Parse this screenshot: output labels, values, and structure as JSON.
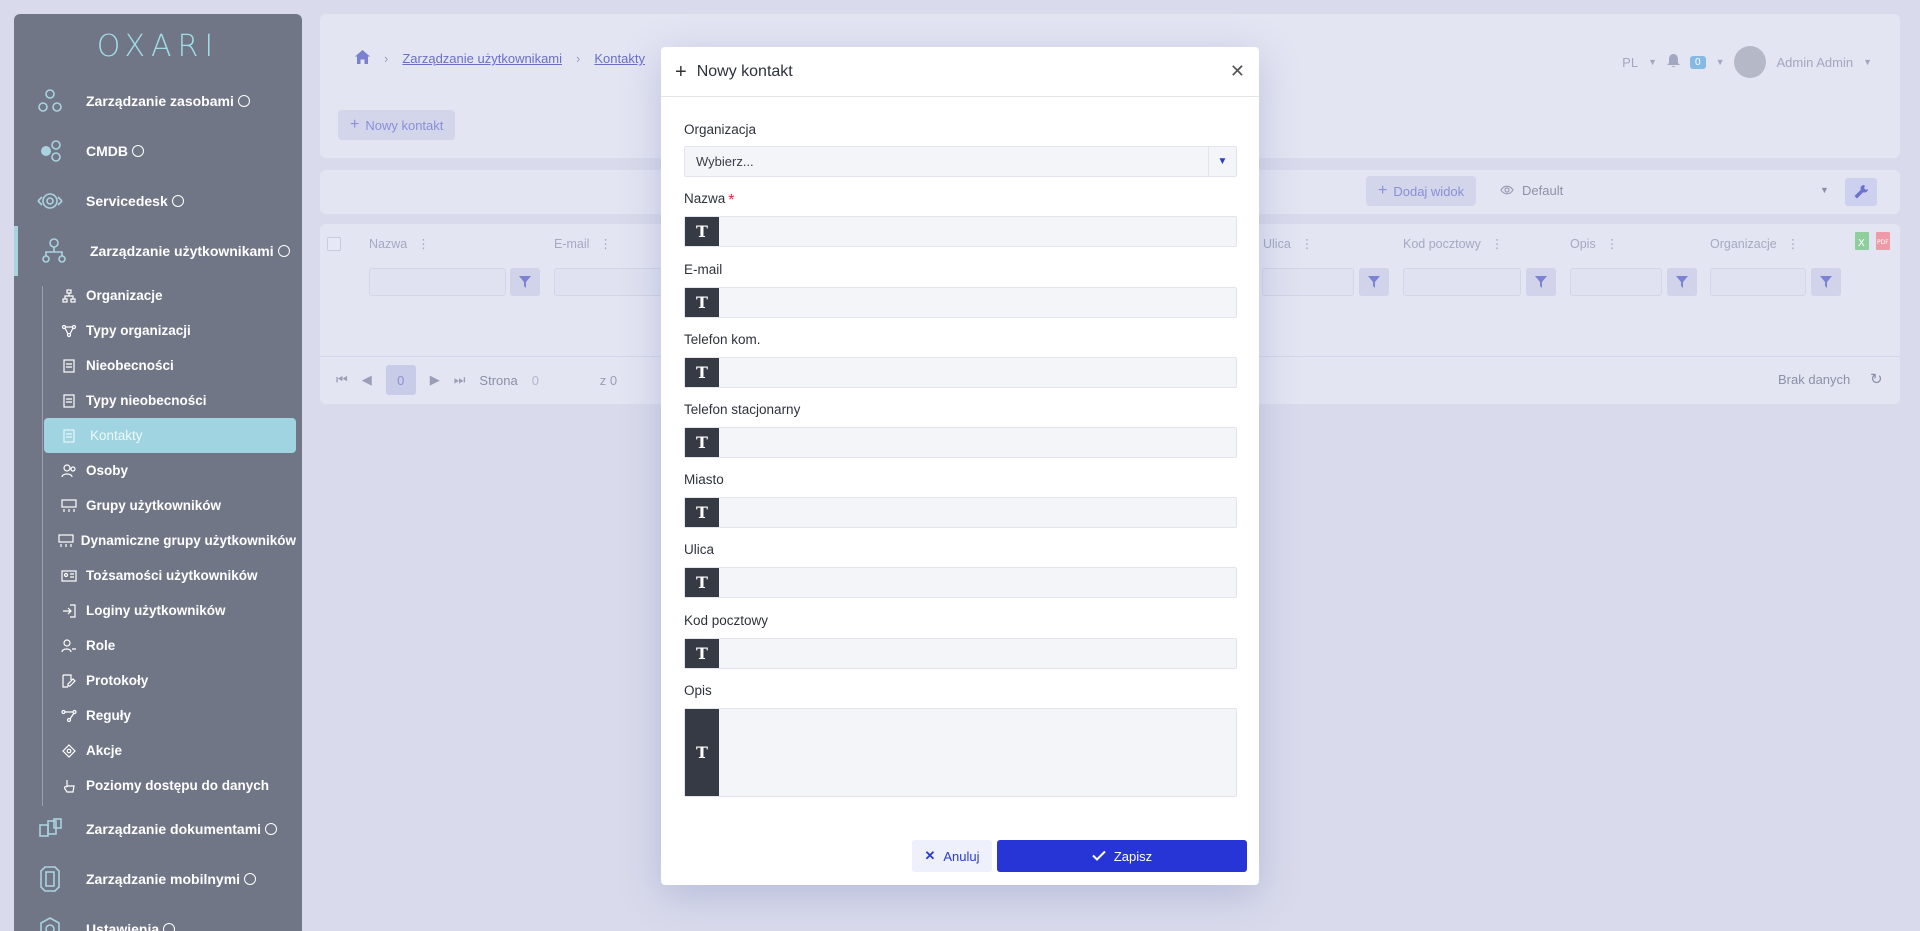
{
  "sidebar": {
    "logo": "OXARI",
    "top_items": [
      {
        "label": "Zarządzanie zasobami"
      },
      {
        "label": "CMDB"
      },
      {
        "label": "Servicedesk"
      },
      {
        "label": "Zarządzanie użytkownikami"
      }
    ],
    "sub_items": [
      {
        "label": "Organizacje"
      },
      {
        "label": "Typy organizacji"
      },
      {
        "label": "Nieobecności"
      },
      {
        "label": "Typy nieobecności"
      },
      {
        "label": "Kontakty"
      },
      {
        "label": "Osoby"
      },
      {
        "label": "Grupy użytkowników"
      },
      {
        "label": "Dynamiczne grupy użytkowników"
      },
      {
        "label": "Tożsamości użytkowników"
      },
      {
        "label": "Loginy użytkowników"
      },
      {
        "label": "Role"
      },
      {
        "label": "Protokoły"
      },
      {
        "label": "Reguły"
      },
      {
        "label": "Akcje"
      },
      {
        "label": "Poziomy dostępu do danych"
      }
    ],
    "bottom_items": [
      {
        "label": "Zarządzanie dokumentami"
      },
      {
        "label": "Zarządzanie mobilnymi"
      },
      {
        "label": "Ustawienia"
      }
    ]
  },
  "breadcrumb": {
    "level1": "Zarządzanie użytkownikami",
    "level2": "Kontakty"
  },
  "header": {
    "language": "PL",
    "notifications": "0",
    "user": "Admin Admin"
  },
  "toolbar": {
    "new_contact": "Nowy kontakt",
    "add_view": "Dodaj widok",
    "view_selected": "Default"
  },
  "grid": {
    "columns": [
      "Nazwa",
      "E-mail",
      "Ulica",
      "Kod pocztowy",
      "Opis",
      "Organizacje"
    ],
    "pager": {
      "page_label": "Strona",
      "current_page": "0",
      "page_input": "0",
      "of_label": "z 0",
      "empty": "Brak danych"
    }
  },
  "modal": {
    "title": "Nowy kontakt",
    "organization_label": "Organizacja",
    "organization_value": "Wybierz...",
    "fields": [
      {
        "label": "Nazwa"
      },
      {
        "label": "E-mail"
      },
      {
        "label": "Telefon kom."
      },
      {
        "label": "Telefon stacjonarny"
      },
      {
        "label": "Miasto"
      },
      {
        "label": "Ulica"
      },
      {
        "label": "Kod pocztowy"
      },
      {
        "label": "Opis"
      }
    ],
    "type_glyph": "T",
    "cancel": "Anuluj",
    "save": "Zapisz"
  }
}
